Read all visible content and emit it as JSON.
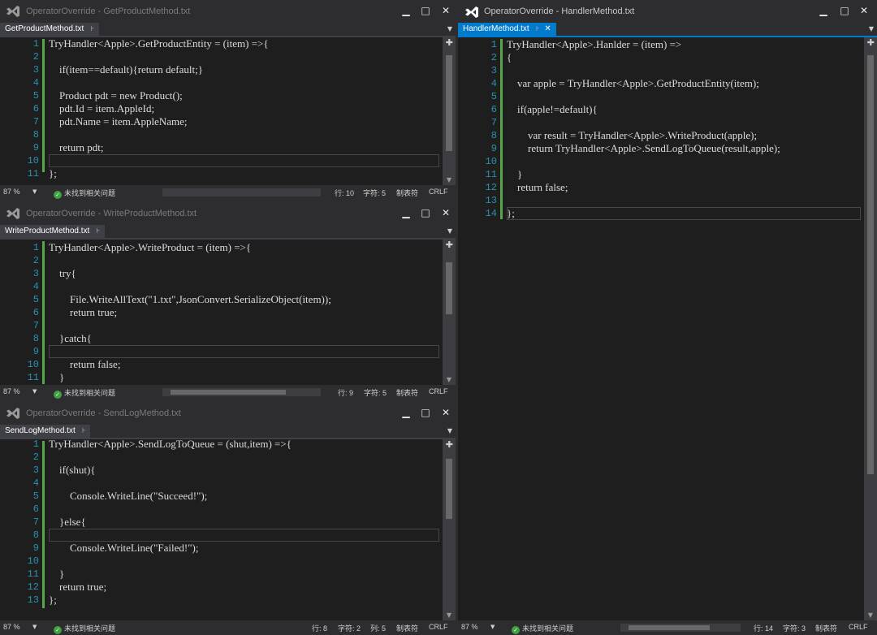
{
  "windows": [
    {
      "id": "get",
      "title": "OperatorOverride - GetProductMethod.txt",
      "tab": "GetProductMethod.txt",
      "lines": [
        "TryHandler<Apple>.GetProductEntity = (item) =>{",
        "",
        "    if(item==default){return default;}",
        "",
        "    Product pdt = new Product();",
        "    pdt.Id = item.AppleId;",
        "    pdt.Name = item.AppleName;",
        "",
        "    return pdt;",
        "",
        "};"
      ],
      "status": {
        "zoom": "87 %",
        "issues": "未找到相关问题",
        "row": "行: 10",
        "col": "字符: 5",
        "tabs": "制表符",
        "eol": "CRLF"
      }
    },
    {
      "id": "write",
      "title": "OperatorOverride - WriteProductMethod.txt",
      "tab": "WriteProductMethod.txt",
      "lines": [
        "TryHandler<Apple>.WriteProduct = (item) =>{",
        "",
        "    try{",
        "",
        "        File.WriteAllText(\"1.txt\",JsonConvert.SerializeObject(item));",
        "        return true;",
        "",
        "    }catch{",
        "",
        "        return false;",
        "    }"
      ],
      "status": {
        "zoom": "87 %",
        "issues": "未找到相关问题",
        "row": "行: 9",
        "col": "字符: 5",
        "tabs": "制表符",
        "eol": "CRLF"
      }
    },
    {
      "id": "log",
      "title": "OperatorOverride - SendLogMethod.txt",
      "tab": "SendLogMethod.txt",
      "lines": [
        "TryHandler<Apple>.SendLogToQueue = (shut,item) =>{",
        "",
        "    if(shut){",
        "",
        "        Console.WriteLine(\"Succeed!\");",
        "",
        "    }else{",
        "",
        "        Console.WriteLine(\"Failed!\");",
        "",
        "    }",
        "    return true;",
        "};"
      ],
      "status": {
        "zoom": "87 %",
        "issues": "未找到相关问题",
        "row": "行: 8",
        "col": "字符: 2",
        "colnum": "列: 5",
        "tabs": "制表符",
        "eol": "CRLF"
      }
    },
    {
      "id": "handler",
      "title": "OperatorOverride - HandlerMethod.txt",
      "tab": "HandlerMethod.txt",
      "lines": [
        "TryHandler<Apple>.Hanlder = (item) =>",
        "{",
        "",
        "    var apple = TryHandler<Apple>.GetProductEntity(item);",
        "",
        "    if(apple!=default){",
        "",
        "        var result = TryHandler<Apple>.WriteProduct(apple);",
        "        return TryHandler<Apple>.SendLogToQueue(result,apple);",
        "",
        "    }",
        "    return false;",
        "",
        "};"
      ],
      "status": {
        "zoom": "87 %",
        "issues": "未找到相关问题",
        "row": "行: 14",
        "col": "字符: 3",
        "tabs": "制表符",
        "eol": "CRLF"
      }
    }
  ],
  "icons": {
    "logo": "visual-studio-logo-icon",
    "minimize": "minimize-icon",
    "maximize": "maximize-icon",
    "close": "close-icon",
    "pin": "pin-icon",
    "dropdown": "chevron-down-icon",
    "split": "split-icon",
    "ok": "check-circle-icon"
  },
  "colors": {
    "accent": "#007acc",
    "line_number": "#2b91af",
    "change_bar": "#57a64a",
    "editor_bg": "#1e1e1e",
    "chrome_bg": "#2d2d30"
  }
}
